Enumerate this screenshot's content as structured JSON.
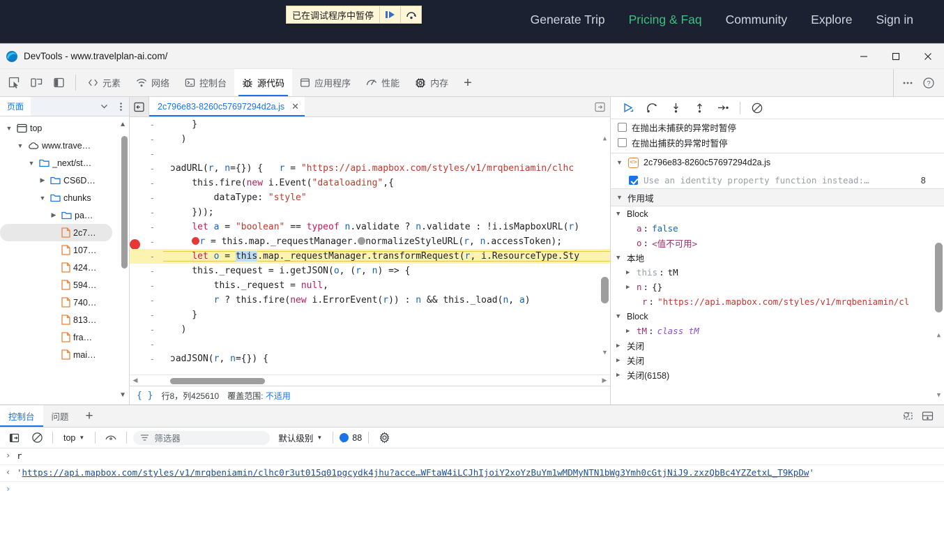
{
  "webpage": {
    "pause_banner": {
      "text": "已在调试程序中暂停",
      "resume_icon": "resume-script-icon",
      "step-over_icon": "step-over-icon"
    },
    "nav": [
      {
        "label": "Generate Trip",
        "active": false
      },
      {
        "label": "Pricing & Faq",
        "active": true
      },
      {
        "label": "Community",
        "active": false
      },
      {
        "label": "Explore",
        "active": false
      },
      {
        "label": "Sign in",
        "active": false
      }
    ],
    "accent_color": "#3fbf7f",
    "bg_color": "#1b2130"
  },
  "devtools": {
    "title": "DevTools - www.travelplan-ai.com/",
    "window_controls": {
      "minimize": "−",
      "maximize": "□",
      "close": "✕"
    },
    "toolbar_icons": [
      "inspect-element-icon",
      "device-toolbar-icon",
      "dock-side-icon"
    ],
    "tabs": [
      {
        "label": "元素",
        "icon": "code-brackets-icon",
        "active": false
      },
      {
        "label": "网络",
        "icon": "wifi-icon",
        "active": false
      },
      {
        "label": "控制台",
        "icon": "terminal-icon",
        "active": false
      },
      {
        "label": "源代码",
        "icon": "bug-icon",
        "active": true
      },
      {
        "label": "应用程序",
        "icon": "application-panel-icon",
        "active": false
      },
      {
        "label": "性能",
        "icon": "performance-icon",
        "active": false
      },
      {
        "label": "内存",
        "icon": "memory-chip-icon",
        "active": false
      }
    ],
    "add_tab_label": "+",
    "more_label": "⋯",
    "help_label": "?"
  },
  "navigator": {
    "tab_label": "页面",
    "more_icon": "kebab-menu-icon",
    "collapse_icon": "chevron-down-icon",
    "tree": [
      {
        "label": "top",
        "depth": 0,
        "twisty": "open",
        "icon": "frame-icon",
        "selected": false
      },
      {
        "label": "www.trave…",
        "depth": 1,
        "twisty": "open",
        "icon": "cloud-icon",
        "selected": false
      },
      {
        "label": "_next/st…",
        "depth": 2,
        "twisty": "open",
        "icon": "folder-icon",
        "selected": false
      },
      {
        "label": "CS6D…",
        "depth": 3,
        "twisty": "closed",
        "icon": "folder-icon",
        "selected": false
      },
      {
        "label": "chunks",
        "depth": 3,
        "twisty": "open",
        "icon": "folder-icon",
        "selected": false
      },
      {
        "label": "pa…",
        "depth": 4,
        "twisty": "closed",
        "icon": "folder-icon",
        "selected": false
      },
      {
        "label": "2c7…",
        "depth": 4,
        "twisty": "none",
        "icon": "js-file-icon",
        "selected": true
      },
      {
        "label": "107…",
        "depth": 4,
        "twisty": "none",
        "icon": "js-file-icon",
        "selected": false
      },
      {
        "label": "424…",
        "depth": 4,
        "twisty": "none",
        "icon": "js-file-icon",
        "selected": false
      },
      {
        "label": "594…",
        "depth": 4,
        "twisty": "none",
        "icon": "js-file-icon",
        "selected": false
      },
      {
        "label": "740…",
        "depth": 4,
        "twisty": "none",
        "icon": "js-file-icon",
        "selected": false
      },
      {
        "label": "813…",
        "depth": 4,
        "twisty": "none",
        "icon": "js-file-icon",
        "selected": false
      },
      {
        "label": "fra…",
        "depth": 4,
        "twisty": "none",
        "icon": "js-file-icon",
        "selected": false
      },
      {
        "label": "mai…",
        "depth": 4,
        "twisty": "none",
        "icon": "js-file-icon",
        "selected": false
      }
    ]
  },
  "editor": {
    "back_icon": "navigate-back-icon",
    "popout_icon": "open-in-new-icon",
    "tab": {
      "filename": "2c796e83-8260c57697294d2a.js",
      "close_label": "✕"
    },
    "status": {
      "format_icon": "{ }",
      "position": "行8，列425610",
      "coverage_label": "覆盖范围",
      "coverage_value": "不适用"
    },
    "lines": [
      {
        "gutter": "-",
        "breakpoint": false,
        "exec": false,
        "code": "    }"
      },
      {
        "gutter": "-",
        "breakpoint": false,
        "exec": false,
        "code": "  )"
      },
      {
        "gutter": "-",
        "breakpoint": false,
        "exec": false,
        "code": ""
      },
      {
        "gutter": "-",
        "breakpoint": false,
        "exec": false,
        "code": "ɔadURL(r, n={}) {   r = \"https://api.mapbox.com/styles/v1/mrqbeniamin/clhc"
      },
      {
        "gutter": "-",
        "breakpoint": false,
        "exec": false,
        "code": "    this.fire(new i.Event(\"dataloading\",{"
      },
      {
        "gutter": "-",
        "breakpoint": false,
        "exec": false,
        "code": "        dataType: \"style\""
      },
      {
        "gutter": "-",
        "breakpoint": false,
        "exec": false,
        "code": "    }));"
      },
      {
        "gutter": "-",
        "breakpoint": false,
        "exec": false,
        "code": "    let a = \"boolean\" == typeof n.validate ? n.validate : !i.isMapboxURL(r)"
      },
      {
        "gutter": "-",
        "breakpoint": true,
        "exec": false,
        "code": "    ●r = this.map._requestManager.●normalizeStyleURL(r, n.accessToken);"
      },
      {
        "gutter": "-",
        "breakpoint": false,
        "exec": true,
        "code": "    let o = this.map._requestManager.transformRequest(r, i.ResourceType.Sty"
      },
      {
        "gutter": "-",
        "breakpoint": false,
        "exec": false,
        "code": "    this._request = i.getJSON(o, (r, n) => {"
      },
      {
        "gutter": "-",
        "breakpoint": false,
        "exec": false,
        "code": "        this._request = null,"
      },
      {
        "gutter": "-",
        "breakpoint": false,
        "exec": false,
        "code": "        r ? this.fire(new i.ErrorEvent(r)) : n && this._load(n, a)"
      },
      {
        "gutter": "-",
        "breakpoint": false,
        "exec": false,
        "code": "    }"
      },
      {
        "gutter": "-",
        "breakpoint": false,
        "exec": false,
        "code": "  )"
      },
      {
        "gutter": "-",
        "breakpoint": false,
        "exec": false,
        "code": ""
      },
      {
        "gutter": "-",
        "breakpoint": false,
        "exec": false,
        "code": "ɔadJSON(r, n={}) {"
      }
    ]
  },
  "debugger": {
    "controls": [
      {
        "name": "resume-script-icon",
        "title": "恢复"
      },
      {
        "name": "step-over-icon",
        "title": "跳过"
      },
      {
        "name": "step-into-icon",
        "title": "进入"
      },
      {
        "name": "step-out-icon",
        "title": "跳出"
      },
      {
        "name": "step-icon",
        "title": "单步"
      },
      {
        "name": "deactivate-breakpoints-icon",
        "title": "停用断点"
      }
    ],
    "pause_options": [
      {
        "label": "在抛出未捕获的异常时暂停",
        "checked": false
      },
      {
        "label": "在抛出捕获的异常时暂停",
        "checked": false
      }
    ],
    "breakpoints": {
      "file": "2c796e83-8260c57697294d2a.js",
      "items": [
        {
          "label": "Use an identity property function instead:…",
          "line": "8",
          "checked": true
        }
      ]
    },
    "scope_header": "作用域",
    "scope": [
      {
        "indent": 0,
        "twisty": "open",
        "label": "Block",
        "type": "section"
      },
      {
        "indent": 1,
        "twisty": "none",
        "name": "a",
        "sep": ": ",
        "value": "false",
        "vclass": "sc-val"
      },
      {
        "indent": 1,
        "twisty": "none",
        "name": "o",
        "sep": ": ",
        "value": "<值不可用>",
        "vclass": "sc-val err"
      },
      {
        "indent": 0,
        "twisty": "open",
        "label": "本地",
        "type": "section"
      },
      {
        "indent": 1,
        "twisty": "closed",
        "name": "this",
        "sep": ": ",
        "value": "tM",
        "vclass": "sc-val plain",
        "nameGray": true
      },
      {
        "indent": 1,
        "twisty": "closed",
        "name": "n",
        "sep": ": ",
        "value": "{}",
        "vclass": "sc-val plain"
      },
      {
        "indent": 2,
        "twisty": "none",
        "name": "r",
        "sep": ": ",
        "value": "\"https://api.mapbox.com/styles/v1/mrqbeniamin/cl",
        "vclass": "sc-val str"
      },
      {
        "indent": 0,
        "twisty": "open",
        "label": "Block",
        "type": "section"
      },
      {
        "indent": 1,
        "twisty": "closed",
        "name": "tM",
        "sep": ": ",
        "value": "class tM",
        "vclass": "sc-val cls"
      },
      {
        "indent": 0,
        "twisty": "closed",
        "label": "关闭",
        "type": "section"
      },
      {
        "indent": 0,
        "twisty": "closed",
        "label": "关闭",
        "type": "section"
      },
      {
        "indent": 0,
        "twisty": "closed",
        "label": "关闭(6158)",
        "type": "section"
      }
    ]
  },
  "drawer": {
    "tabs": [
      {
        "label": "控制台",
        "active": true
      },
      {
        "label": "问题",
        "active": false
      }
    ],
    "add_label": "+",
    "right_icons": [
      "restore-drawer-icon",
      "dock-bottom-icon"
    ],
    "console_toolbar": {
      "clear_icon": "clear-console-icon",
      "no-entry_icon": "no-entry-icon",
      "context": "top",
      "eye_icon": "live-expression-icon",
      "filter_icon": "filter-icon",
      "filter_placeholder": "筛选器",
      "level": "默认级别",
      "issue_count": "88",
      "settings_icon": "gear-icon"
    },
    "messages": [
      {
        "kind": "input",
        "arrow": "›",
        "text": "r"
      },
      {
        "kind": "output",
        "arrow": "‹",
        "prefix": "'",
        "url": "https://api.mapbox.com/styles/v1/mrqbeniamin/clhc0r3ut015q01pgcydk4jhu?acce…WFtaW4iLCJhIjoiY2xoYzBuYm1wMDMyNTN1bWg3Ymh0cGtjNiJ9.zxzQbBc4YZZetxL_T9KpDw",
        "suffix": "'"
      },
      {
        "kind": "prompt",
        "arrow": "›",
        "text": ""
      }
    ]
  }
}
